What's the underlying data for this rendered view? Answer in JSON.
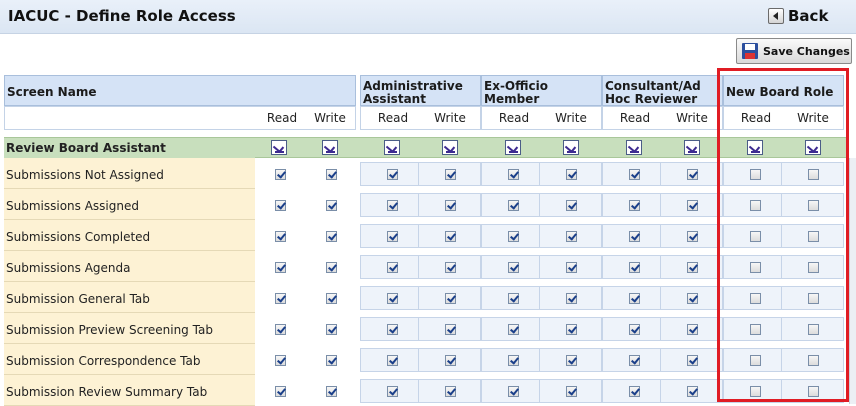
{
  "title": "IACUC - Define Role Access",
  "back_label": "Back",
  "save_label": "Save Changes",
  "screen_name_header": "Screen Name",
  "read_label": "Read",
  "write_label": "Write",
  "roles": [
    {
      "line1": "Administrative",
      "line2": "Assistant"
    },
    {
      "line1": "Ex-Officio",
      "line2": "Member"
    },
    {
      "line1": "Consultant/Ad",
      "line2": "Hoc Reviewer"
    },
    {
      "line1": "New Board Role",
      "line2": ""
    }
  ],
  "group_label": "Review Board Assistant",
  "rows": [
    {
      "name": "Submissions Not Assigned"
    },
    {
      "name": "Submissions Assigned"
    },
    {
      "name": "Submissions Completed"
    },
    {
      "name": "Submissions Agenda"
    },
    {
      "name": "Submission General Tab"
    },
    {
      "name": "Submission Preview Screening Tab"
    },
    {
      "name": "Submission Correspondence Tab"
    },
    {
      "name": "Submission Review Summary Tab"
    }
  ],
  "checked": {
    "screen": [
      true,
      true
    ],
    "administrative_assistant": [
      true,
      true
    ],
    "ex_officio_member": [
      true,
      true
    ],
    "consultant_ad_hoc_reviewer": [
      true,
      true
    ],
    "new_board_role": [
      false,
      false
    ]
  }
}
